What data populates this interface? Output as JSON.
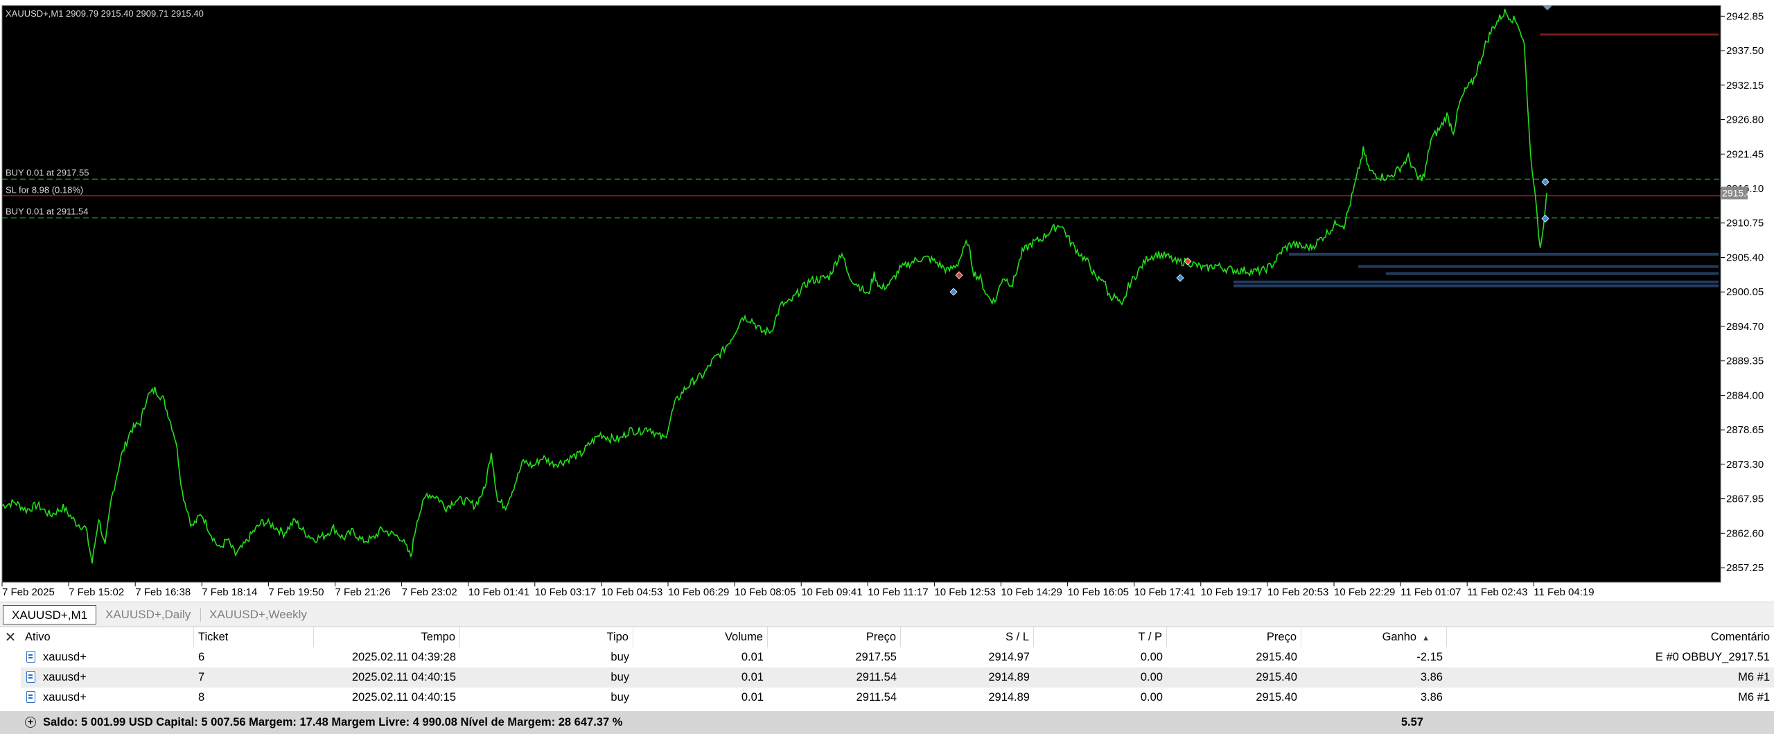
{
  "chart": {
    "symbol_info": "XAUUSD+,M1  2909.79 2915.40 2909.71 2915.40",
    "current_price": "2915.40",
    "price_levels": [
      "2942.85",
      "2937.50",
      "2932.15",
      "2926.80",
      "2921.45",
      "2916.10",
      "2910.75",
      "2905.40",
      "2900.05",
      "2894.70",
      "2889.35",
      "2884.00",
      "2878.65",
      "2873.30",
      "2867.95",
      "2862.60",
      "2857.25"
    ],
    "time_labels": [
      "7 Feb 2025",
      "7 Feb 15:02",
      "7 Feb 16:38",
      "7 Feb 18:14",
      "7 Feb 19:50",
      "7 Feb 21:26",
      "7 Feb 23:02",
      "10 Feb 01:41",
      "10 Feb 03:17",
      "10 Feb 04:53",
      "10 Feb 06:29",
      "10 Feb 08:05",
      "10 Feb 09:41",
      "10 Feb 11:17",
      "10 Feb 12:53",
      "10 Feb 14:29",
      "10 Feb 16:05",
      "10 Feb 17:41",
      "10 Feb 19:17",
      "10 Feb 20:53",
      "10 Feb 22:29",
      "11 Feb 01:07",
      "11 Feb 02:43",
      "11 Feb 04:19"
    ],
    "overlays": {
      "buy1": "BUY 0.01 at 2917.55",
      "sl": "SL for 8.98 (0.18%)",
      "buy2": "BUY 0.01 at 2911.54"
    },
    "levels": {
      "buy1_price": 2917.55,
      "sl_price": 2914.97,
      "buy2_price": 2911.54,
      "red_top_price": 2940.0
    },
    "colors": {
      "price_line": "#22e01a",
      "background": "#000000",
      "trade_level": "#1aa01a",
      "sl_level": "#b02020",
      "volume_bars": "#233a5e"
    },
    "trend_points": [
      [
        0,
        2866.9
      ],
      [
        8,
        2867.4
      ],
      [
        15,
        2866.2
      ],
      [
        22,
        2867.0
      ],
      [
        30,
        2865.4
      ],
      [
        38,
        2866.6
      ],
      [
        46,
        2864.2
      ],
      [
        52,
        2863.4
      ],
      [
        56,
        2858.0
      ],
      [
        60,
        2865.0
      ],
      [
        64,
        2860.5
      ],
      [
        68,
        2868.0
      ],
      [
        74,
        2874.5
      ],
      [
        80,
        2878.6
      ],
      [
        86,
        2879.8
      ],
      [
        90,
        2883.8
      ],
      [
        95,
        2884.9
      ],
      [
        100,
        2883.5
      ],
      [
        104,
        2880.5
      ],
      [
        108,
        2877.0
      ],
      [
        112,
        2869.0
      ],
      [
        118,
        2863.6
      ],
      [
        124,
        2865.6
      ],
      [
        130,
        2862.4
      ],
      [
        135,
        2860.2
      ],
      [
        140,
        2861.6
      ],
      [
        145,
        2859.3
      ],
      [
        150,
        2860.6
      ],
      [
        156,
        2862.8
      ],
      [
        162,
        2864.4
      ],
      [
        168,
        2863.9
      ],
      [
        175,
        2862.6
      ],
      [
        182,
        2864.6
      ],
      [
        188,
        2862.7
      ],
      [
        194,
        2861.7
      ],
      [
        200,
        2862.2
      ],
      [
        206,
        2863.4
      ],
      [
        212,
        2861.8
      ],
      [
        218,
        2862.9
      ],
      [
        224,
        2861.4
      ],
      [
        230,
        2861.7
      ],
      [
        236,
        2863.2
      ],
      [
        242,
        2862.5
      ],
      [
        248,
        2861.9
      ],
      [
        254,
        2859.0
      ],
      [
        258,
        2864.8
      ],
      [
        264,
        2868.7
      ],
      [
        270,
        2868.3
      ],
      [
        276,
        2866.6
      ],
      [
        282,
        2867.8
      ],
      [
        288,
        2867.6
      ],
      [
        294,
        2866.9
      ],
      [
        300,
        2869.5
      ],
      [
        304,
        2875.4
      ],
      [
        308,
        2867.6
      ],
      [
        313,
        2866.8
      ],
      [
        318,
        2869.8
      ],
      [
        324,
        2873.8
      ],
      [
        330,
        2873.0
      ],
      [
        336,
        2874.4
      ],
      [
        342,
        2873.4
      ],
      [
        348,
        2873.6
      ],
      [
        354,
        2874.4
      ],
      [
        360,
        2874.9
      ],
      [
        366,
        2876.7
      ],
      [
        372,
        2878.0
      ],
      [
        378,
        2877.3
      ],
      [
        384,
        2877.2
      ],
      [
        390,
        2878.6
      ],
      [
        396,
        2878.4
      ],
      [
        402,
        2879.0
      ],
      [
        408,
        2877.7
      ],
      [
        412,
        2877.3
      ],
      [
        418,
        2882.7
      ],
      [
        424,
        2884.9
      ],
      [
        430,
        2886.3
      ],
      [
        436,
        2887.2
      ],
      [
        442,
        2889.5
      ],
      [
        448,
        2890.9
      ],
      [
        454,
        2893.1
      ],
      [
        460,
        2896.2
      ],
      [
        466,
        2895.7
      ],
      [
        472,
        2893.9
      ],
      [
        478,
        2894.0
      ],
      [
        484,
        2898.0
      ],
      [
        490,
        2898.5
      ],
      [
        496,
        2900.3
      ],
      [
        502,
        2901.8
      ],
      [
        508,
        2902.0
      ],
      [
        514,
        2902.4
      ],
      [
        518,
        2904.5
      ],
      [
        522,
        2906.2
      ],
      [
        526,
        2902.5
      ],
      [
        530,
        2901.6
      ],
      [
        534,
        2900.7
      ],
      [
        538,
        2899.5
      ],
      [
        542,
        2902.8
      ],
      [
        546,
        2900.5
      ],
      [
        552,
        2901.4
      ],
      [
        558,
        2903.6
      ],
      [
        564,
        2904.5
      ],
      [
        570,
        2905.2
      ],
      [
        576,
        2905.3
      ],
      [
        582,
        2904.4
      ],
      [
        588,
        2903.3
      ],
      [
        594,
        2904.5
      ],
      [
        600,
        2907.9
      ],
      [
        604,
        2903.0
      ],
      [
        608,
        2902.1
      ],
      [
        612,
        2899.5
      ],
      [
        617,
        2898.5
      ],
      [
        622,
        2902.4
      ],
      [
        628,
        2901.2
      ],
      [
        634,
        2906.2
      ],
      [
        640,
        2907.6
      ],
      [
        646,
        2908.3
      ],
      [
        652,
        2909.6
      ],
      [
        658,
        2910.6
      ],
      [
        664,
        2907.8
      ],
      [
        670,
        2905.9
      ],
      [
        676,
        2904.3
      ],
      [
        680,
        2901.9
      ],
      [
        684,
        2902.3
      ],
      [
        688,
        2899.5
      ],
      [
        692,
        2899.2
      ],
      [
        696,
        2897.6
      ],
      [
        700,
        2900.9
      ],
      [
        706,
        2903.2
      ],
      [
        712,
        2905.4
      ],
      [
        718,
        2905.9
      ],
      [
        724,
        2905.6
      ],
      [
        730,
        2904.6
      ],
      [
        736,
        2904.8
      ],
      [
        742,
        2904.2
      ],
      [
        748,
        2903.6
      ],
      [
        754,
        2904.2
      ],
      [
        760,
        2903.7
      ],
      [
        766,
        2903.4
      ],
      [
        772,
        2903.4
      ],
      [
        778,
        2903.2
      ],
      [
        784,
        2903.4
      ],
      [
        790,
        2904.4
      ],
      [
        796,
        2906.6
      ],
      [
        802,
        2907.6
      ],
      [
        808,
        2907.0
      ],
      [
        814,
        2907.0
      ],
      [
        820,
        2908.4
      ],
      [
        826,
        2909.8
      ],
      [
        830,
        2911.0
      ],
      [
        834,
        2910.4
      ],
      [
        838,
        2913.9
      ],
      [
        842,
        2917.9
      ],
      [
        846,
        2922.0
      ],
      [
        850,
        2918.8
      ],
      [
        856,
        2918.0
      ],
      [
        862,
        2917.8
      ],
      [
        868,
        2919.1
      ],
      [
        874,
        2920.9
      ],
      [
        880,
        2917.6
      ],
      [
        884,
        2918.1
      ],
      [
        888,
        2923.7
      ],
      [
        894,
        2925.6
      ],
      [
        898,
        2927.5
      ],
      [
        902,
        2924.9
      ],
      [
        906,
        2929.4
      ],
      [
        910,
        2931.6
      ],
      [
        914,
        2932.6
      ],
      [
        918,
        2935.4
      ],
      [
        922,
        2938.5
      ],
      [
        926,
        2940.8
      ],
      [
        930,
        2942.3
      ],
      [
        934,
        2943.5
      ],
      [
        938,
        2942.6
      ],
      [
        942,
        2941.8
      ],
      [
        946,
        2938.5
      ],
      [
        948,
        2930.0
      ],
      [
        950,
        2921.0
      ],
      [
        952,
        2917.4
      ],
      [
        954,
        2911.5
      ],
      [
        956,
        2906.8
      ],
      [
        958,
        2910.8
      ],
      [
        960,
        2915.4
      ]
    ]
  },
  "tabs": [
    "XAUUSD+,M1",
    "XAUUSD+,Daily",
    "XAUUSD+,Weekly"
  ],
  "table": {
    "headers": {
      "ativo": "Ativo",
      "ticket": "Ticket",
      "tempo": "Tempo",
      "tipo": "Tipo",
      "volume": "Volume",
      "preco": "Preço",
      "sl": "S / L",
      "tp": "T / P",
      "preco2": "Preço",
      "ganho": "Ganho",
      "comentario": "Comentário"
    },
    "rows": [
      {
        "ativo": "xauusd+",
        "ticket": "6",
        "tempo": "2025.02.11 04:39:28",
        "tipo": "buy",
        "volume": "0.01",
        "preco": "2917.55",
        "sl": "2914.97",
        "tp": "0.00",
        "preco2": "2915.40",
        "ganho": "-2.15",
        "comentario": "E #0 OBBUY_2917.51"
      },
      {
        "ativo": "xauusd+",
        "ticket": "7",
        "tempo": "2025.02.11 04:40:15",
        "tipo": "buy",
        "volume": "0.01",
        "preco": "2911.54",
        "sl": "2914.89",
        "tp": "0.00",
        "preco2": "2915.40",
        "ganho": "3.86",
        "comentario": "M6 #1"
      },
      {
        "ativo": "xauusd+",
        "ticket": "8",
        "tempo": "2025.02.11 04:40:15",
        "tipo": "buy",
        "volume": "0.01",
        "preco": "2911.54",
        "sl": "2914.89",
        "tp": "0.00",
        "preco2": "2915.40",
        "ganho": "3.86",
        "comentario": "M6 #1"
      }
    ],
    "summary": "Saldo: 5 001.99 USD  Capital: 5 007.56  Margem: 17.48  Margem Livre: 4 990.08  Nível de Margem: 28 647.37 %",
    "summary_total": "5.57"
  }
}
